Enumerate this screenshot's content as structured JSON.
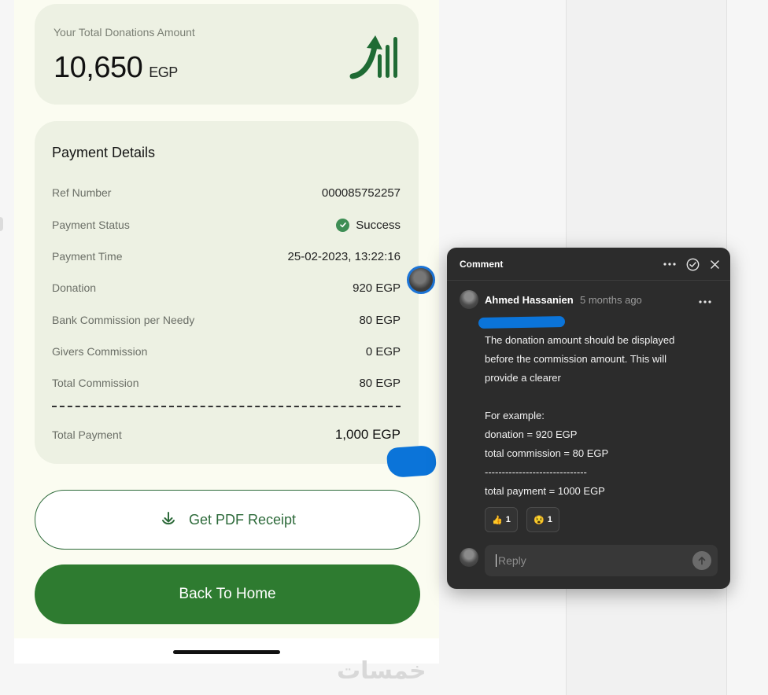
{
  "total_card": {
    "label": "Your Total Donations Amount",
    "amount": "10,650",
    "currency": "EGP"
  },
  "details": {
    "title": "Payment Details",
    "rows": [
      {
        "label": "Ref Number",
        "value": "000085752257"
      },
      {
        "label": "Payment Status",
        "value": "Success"
      },
      {
        "label": "Payment Time",
        "value": "25-02-2023, 13:22:16"
      },
      {
        "label": "Donation",
        "value": "920 EGP"
      },
      {
        "label": "Bank Commission per Needy",
        "value": "80 EGP"
      },
      {
        "label": "Givers Commission",
        "value": "0 EGP"
      },
      {
        "label": "Total Commission",
        "value": "80 EGP"
      }
    ],
    "total": {
      "label": "Total Payment",
      "value": "1,000 EGP"
    }
  },
  "buttons": {
    "pdf_label": "Get PDF Receipt",
    "home_label": "Back To Home"
  },
  "watermark": "خمسات",
  "comment": {
    "title": "Comment",
    "author": "Ahmed Hassanien",
    "time": "5 months ago",
    "lines": [
      "The donation amount should be displayed",
      "before the commission amount. This will",
      "provide a clearer",
      "",
      "For example:",
      "donation = 920 EGP",
      "total commission = 80 EGP",
      "------------------------------",
      "total payment = 1000 EGP"
    ],
    "reactions": [
      {
        "emoji": "👍",
        "count": "1"
      },
      {
        "emoji": "😵",
        "count": "1"
      }
    ],
    "reply_placeholder": "Reply"
  },
  "colors": {
    "brand_green": "#2e7b30",
    "card_bg": "#edf1e3",
    "success": "#3e8e55",
    "annotation_blue": "#0b74d9"
  }
}
